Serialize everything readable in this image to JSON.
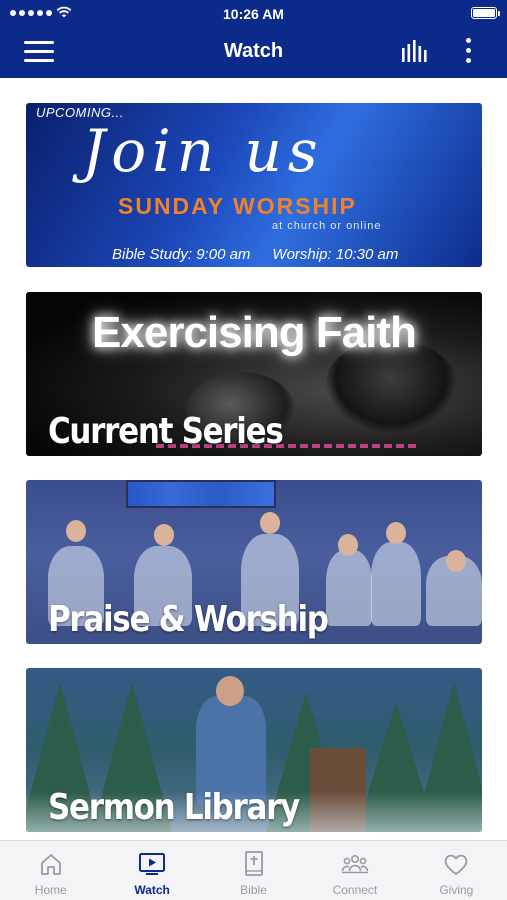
{
  "status_bar": {
    "time": "10:26 AM",
    "signal_icon": "signal-dots-icon",
    "wifi_icon": "wifi-icon",
    "battery_icon": "battery-icon",
    "battery_level": 1.0
  },
  "nav": {
    "title": "Watch",
    "menu_icon": "hamburger-menu-icon",
    "audio_icon": "audio-levels-icon",
    "more_icon": "more-vertical-icon"
  },
  "colors": {
    "brand": "#0b2a8a",
    "tab_inactive": "#9a9aa0",
    "accent_orange": "#f0832a"
  },
  "cards": {
    "upcoming": {
      "kicker": "UPCOMING...",
      "script": "Join us",
      "headline": "SUNDAY WORSHIP",
      "subline": "at church or online",
      "bible_study": "Bible Study: 9:00 am",
      "worship_time": "Worship: 10:30 am"
    },
    "series": {
      "headline": "Exercising Faith",
      "label": "Current Series"
    },
    "praise": {
      "label": "Praise & Worship"
    },
    "sermon": {
      "label": "Sermon Library"
    }
  },
  "tabs": [
    {
      "label": "Home",
      "icon": "home-icon",
      "active": false
    },
    {
      "label": "Watch",
      "icon": "tv-play-icon",
      "active": true
    },
    {
      "label": "Bible",
      "icon": "bible-cross-icon",
      "active": false
    },
    {
      "label": "Connect",
      "icon": "people-group-icon",
      "active": false
    },
    {
      "label": "Giving",
      "icon": "heart-icon",
      "active": false
    }
  ]
}
